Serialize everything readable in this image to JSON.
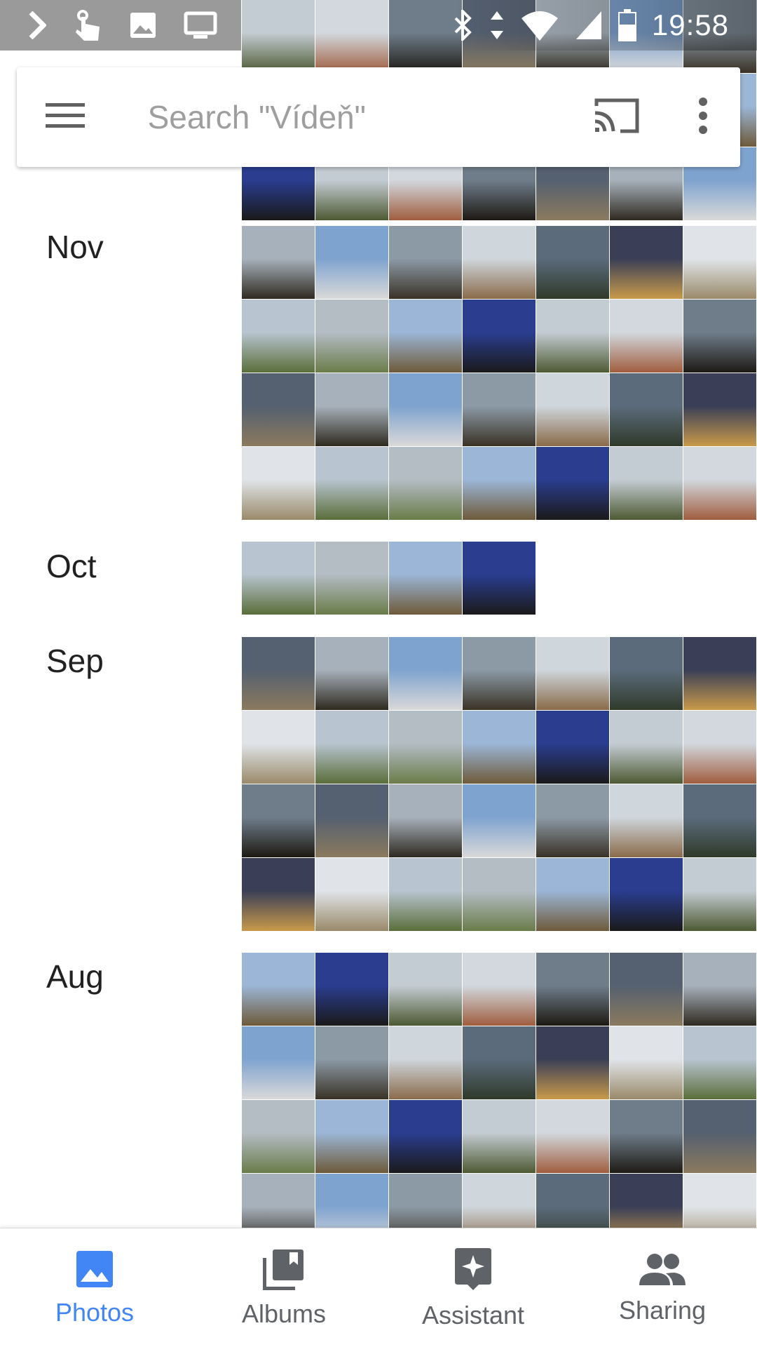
{
  "status_bar": {
    "time": "19:58",
    "icons_left": [
      "chevron-right-icon",
      "touch-gesture-icon",
      "image-icon",
      "monitor-icon"
    ],
    "icons_right": [
      "bluetooth-icon",
      "data-arrows-icon",
      "wifi-icon",
      "signal-icon",
      "battery-icon"
    ]
  },
  "search": {
    "placeholder": "Search \"Vídeň\""
  },
  "months": [
    {
      "label": "Nov",
      "photo_count": 28
    },
    {
      "label": "Oct",
      "photo_count": 4
    },
    {
      "label": "Sep",
      "photo_count": 28
    },
    {
      "label": "Aug",
      "photo_count": 28
    }
  ],
  "bottom_nav": {
    "items": [
      {
        "label": "Photos",
        "icon": "photo-icon",
        "active": true
      },
      {
        "label": "Albums",
        "icon": "albums-icon",
        "active": false
      },
      {
        "label": "Assistant",
        "icon": "assistant-icon",
        "active": false
      },
      {
        "label": "Sharing",
        "icon": "people-icon",
        "active": false
      }
    ]
  },
  "colors": {
    "accent": "#4285f4",
    "nav_inactive": "#5f6368",
    "status_bar_left": "#9a9a9a"
  }
}
